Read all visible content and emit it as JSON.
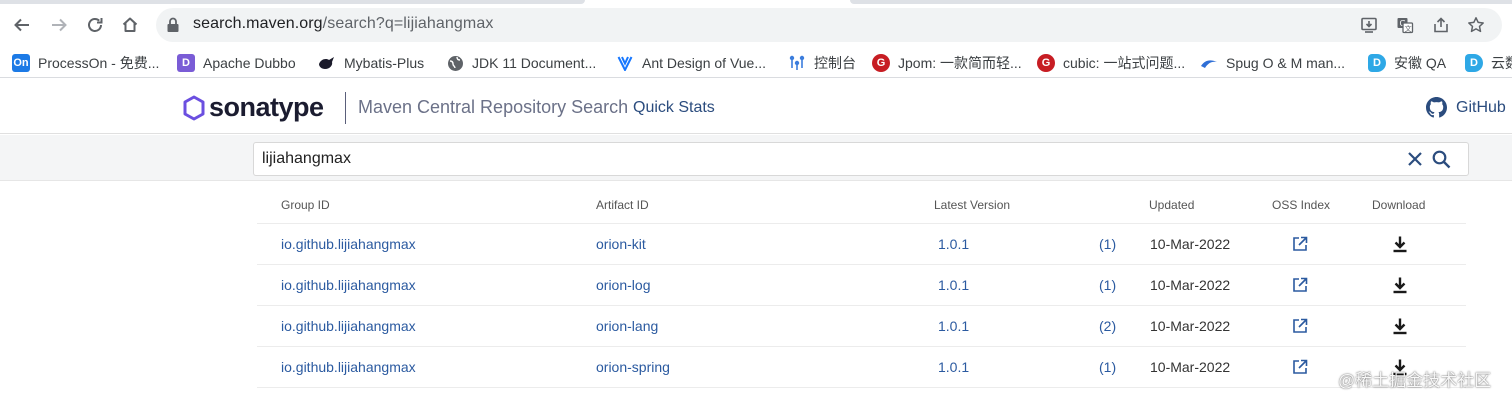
{
  "browser": {
    "url_host": "search.maven.org",
    "url_path": "/search?q=lijiahangmax",
    "bookmarks": [
      {
        "label": "ProcessOn - 免费...",
        "icon": "processon-icon",
        "badge": "On",
        "color": "#1c7ae6"
      },
      {
        "label": "Apache Dubbo",
        "icon": "dubbo-icon",
        "badge": "D",
        "color": "#7a5cd6"
      },
      {
        "label": "Mybatis-Plus",
        "icon": "mybatis-icon",
        "badge": "",
        "color": "#1b1b2b"
      },
      {
        "label": "JDK 11 Document...",
        "icon": "globe-icon",
        "badge": "",
        "color": "#5f6368"
      },
      {
        "label": "Ant Design of Vue...",
        "icon": "antd-icon",
        "badge": "",
        "color": "#1677ff"
      },
      {
        "label": "控制台",
        "icon": "console-icon",
        "badge": "",
        "color": "#3b7ddd"
      },
      {
        "label": "Jpom: 一款简而轻...",
        "icon": "gitee-icon",
        "badge": "G",
        "color": "#c71d23"
      },
      {
        "label": "cubic: 一站式问题...",
        "icon": "gitee-icon",
        "badge": "G",
        "color": "#c71d23"
      },
      {
        "label": "Spug O & M man...",
        "icon": "spug-icon",
        "badge": "",
        "color": "#2f6fd6"
      },
      {
        "label": "安徽 QA",
        "icon": "d-icon",
        "badge": "D",
        "color": "#2ea8e6"
      },
      {
        "label": "云数",
        "icon": "d-icon",
        "badge": "D",
        "color": "#2ea8e6"
      }
    ]
  },
  "header": {
    "logo": "sonatype",
    "site_title": "Maven Central Repository Search",
    "quick_stats": "Quick Stats",
    "github": "GitHub"
  },
  "search": {
    "value": "lijiahangmax"
  },
  "table": {
    "columns": {
      "group_id": "Group ID",
      "artifact_id": "Artifact ID",
      "latest_version": "Latest Version",
      "updated": "Updated",
      "oss_index": "OSS Index",
      "download": "Download"
    },
    "rows": [
      {
        "group_id": "io.github.lijiahangmax",
        "artifact_id": "orion-kit",
        "version": "1.0.1",
        "count": "(1)",
        "updated": "10-Mar-2022"
      },
      {
        "group_id": "io.github.lijiahangmax",
        "artifact_id": "orion-log",
        "version": "1.0.1",
        "count": "(1)",
        "updated": "10-Mar-2022"
      },
      {
        "group_id": "io.github.lijiahangmax",
        "artifact_id": "orion-lang",
        "version": "1.0.1",
        "count": "(2)",
        "updated": "10-Mar-2022"
      },
      {
        "group_id": "io.github.lijiahangmax",
        "artifact_id": "orion-spring",
        "version": "1.0.1",
        "count": "(1)",
        "updated": "10-Mar-2022"
      }
    ]
  },
  "watermark": "@稀土掘金技术社区",
  "colors": {
    "link": "#2b5aa0",
    "logo_accent": "#6b4fe0",
    "header_text": "#2b4c7e"
  }
}
